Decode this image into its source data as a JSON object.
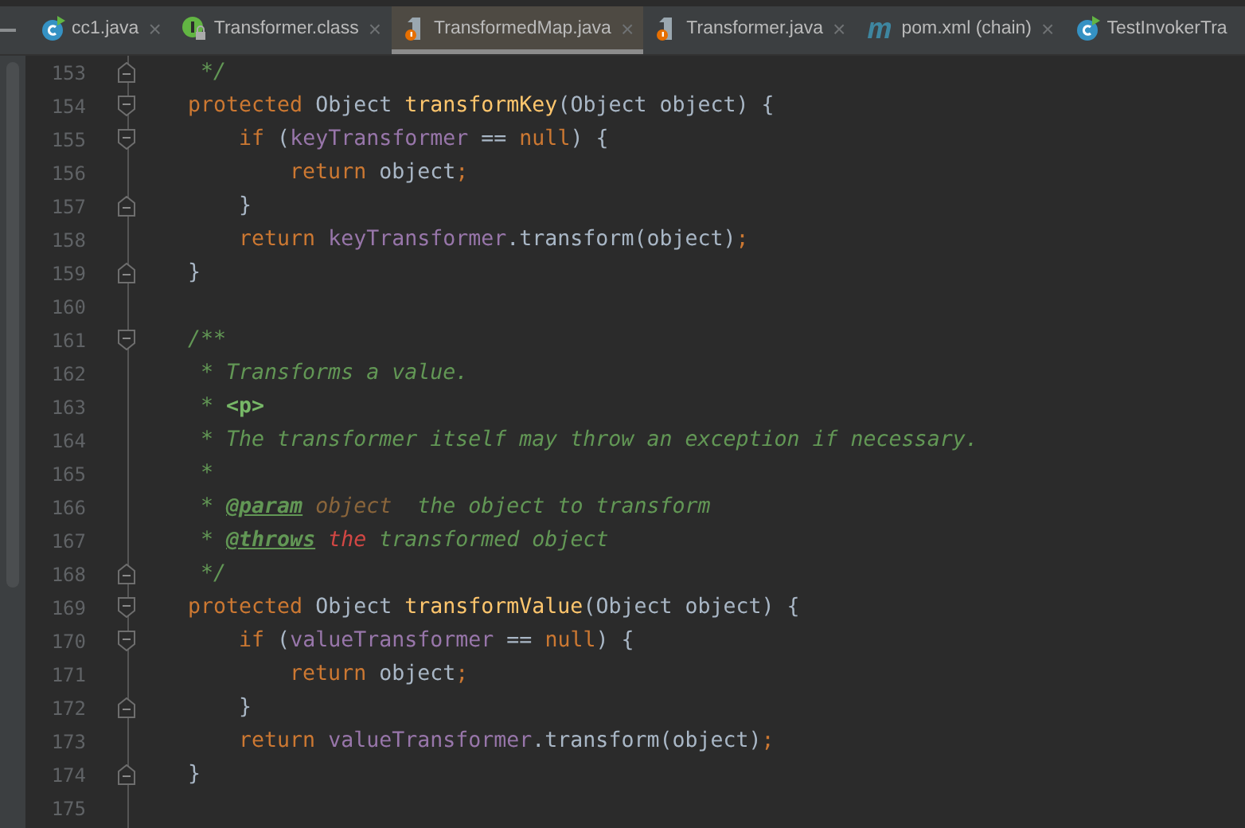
{
  "tabs": [
    {
      "label": "cc1.java",
      "kind": "class",
      "selected": false,
      "closable": true
    },
    {
      "label": "Transformer.class",
      "kind": "interface",
      "selected": false,
      "closable": true
    },
    {
      "label": "TransformedMap.java",
      "kind": "java",
      "selected": true,
      "closable": true
    },
    {
      "label": "Transformer.java",
      "kind": "java",
      "selected": false,
      "closable": true
    },
    {
      "label": "pom.xml (chain)",
      "kind": "maven",
      "selected": false,
      "closable": true
    },
    {
      "label": "TestInvokerTra",
      "kind": "class",
      "selected": false,
      "closable": false
    }
  ],
  "close_glyph": "×",
  "lines": [
    {
      "number": "153",
      "fold": {
        "kind": "end"
      },
      "tokens": [
        {
          "kind": "comment",
          "text": " */"
        }
      ]
    },
    {
      "number": "154",
      "fold": {
        "kind": "start"
      },
      "tokens": [
        {
          "kind": "keyword",
          "text": "protected "
        },
        {
          "kind": "plain",
          "text": "Object "
        },
        {
          "kind": "method",
          "text": "transformKey"
        },
        {
          "kind": "plain",
          "text": "(Object object) {"
        }
      ]
    },
    {
      "number": "155",
      "fold": {
        "kind": "start"
      },
      "tokens": [
        {
          "kind": "keyword",
          "text": "    if "
        },
        {
          "kind": "plain",
          "text": "("
        },
        {
          "kind": "field",
          "text": "keyTransformer"
        },
        {
          "kind": "plain",
          "text": " == "
        },
        {
          "kind": "keyword",
          "text": "null"
        },
        {
          "kind": "plain",
          "text": ") {"
        }
      ]
    },
    {
      "number": "156",
      "tokens": [
        {
          "kind": "keyword",
          "text": "        return "
        },
        {
          "kind": "plain",
          "text": "object"
        },
        {
          "kind": "keyword",
          "text": ";"
        }
      ]
    },
    {
      "number": "157",
      "fold": {
        "kind": "end"
      },
      "tokens": [
        {
          "kind": "plain",
          "text": "    }"
        }
      ]
    },
    {
      "number": "158",
      "tokens": [
        {
          "kind": "keyword",
          "text": "    return "
        },
        {
          "kind": "field",
          "text": "keyTransformer"
        },
        {
          "kind": "plain",
          "text": ".transform(object)"
        },
        {
          "kind": "keyword",
          "text": ";"
        }
      ]
    },
    {
      "number": "159",
      "fold": {
        "kind": "end"
      },
      "tokens": [
        {
          "kind": "plain",
          "text": "}"
        }
      ]
    },
    {
      "number": "160"
    },
    {
      "number": "161",
      "fold": {
        "kind": "start"
      },
      "tokens": [
        {
          "kind": "comment",
          "text": "/**"
        }
      ]
    },
    {
      "number": "162",
      "tokens": [
        {
          "kind": "comment",
          "text": " * Transforms a value."
        }
      ]
    },
    {
      "number": "163",
      "tokens": [
        {
          "kind": "comment",
          "text": " * "
        },
        {
          "kind": "html",
          "text": "<p>"
        }
      ]
    },
    {
      "number": "164",
      "tokens": [
        {
          "kind": "comment",
          "text": " * The transformer itself may throw an exception if necessary."
        }
      ]
    },
    {
      "number": "165",
      "tokens": [
        {
          "kind": "comment",
          "text": " *"
        }
      ]
    },
    {
      "number": "166",
      "tokens": [
        {
          "kind": "comment",
          "text": " * "
        },
        {
          "kind": "doctag",
          "text": "@param"
        },
        {
          "kind": "docparam",
          "text": " object"
        },
        {
          "kind": "comment",
          "text": "  the object to transform"
        }
      ]
    },
    {
      "number": "167",
      "tokens": [
        {
          "kind": "comment",
          "text": " * "
        },
        {
          "kind": "doctag",
          "text": "@throws"
        },
        {
          "kind": "error",
          "text": " the"
        },
        {
          "kind": "comment",
          "text": " transformed object"
        }
      ]
    },
    {
      "number": "168",
      "fold": {
        "kind": "end"
      },
      "tokens": [
        {
          "kind": "comment",
          "text": " */"
        }
      ]
    },
    {
      "number": "169",
      "fold": {
        "kind": "start"
      },
      "tokens": [
        {
          "kind": "keyword",
          "text": "protected "
        },
        {
          "kind": "plain",
          "text": "Object "
        },
        {
          "kind": "method",
          "text": "transformValue"
        },
        {
          "kind": "plain",
          "text": "(Object object) {"
        }
      ]
    },
    {
      "number": "170",
      "fold": {
        "kind": "start"
      },
      "tokens": [
        {
          "kind": "keyword",
          "text": "    if "
        },
        {
          "kind": "plain",
          "text": "("
        },
        {
          "kind": "field",
          "text": "valueTransformer"
        },
        {
          "kind": "plain",
          "text": " == "
        },
        {
          "kind": "keyword",
          "text": "null"
        },
        {
          "kind": "plain",
          "text": ") {"
        }
      ]
    },
    {
      "number": "171",
      "tokens": [
        {
          "kind": "keyword",
          "text": "        return "
        },
        {
          "kind": "plain",
          "text": "object"
        },
        {
          "kind": "keyword",
          "text": ";"
        }
      ]
    },
    {
      "number": "172",
      "fold": {
        "kind": "end"
      },
      "tokens": [
        {
          "kind": "plain",
          "text": "    }"
        }
      ]
    },
    {
      "number": "173",
      "tokens": [
        {
          "kind": "keyword",
          "text": "    return "
        },
        {
          "kind": "field",
          "text": "valueTransformer"
        },
        {
          "kind": "plain",
          "text": ".transform(object)"
        },
        {
          "kind": "keyword",
          "text": ";"
        }
      ]
    },
    {
      "number": "174",
      "fold": {
        "kind": "end"
      },
      "tokens": [
        {
          "kind": "plain",
          "text": "}"
        }
      ]
    },
    {
      "number": "175"
    }
  ]
}
